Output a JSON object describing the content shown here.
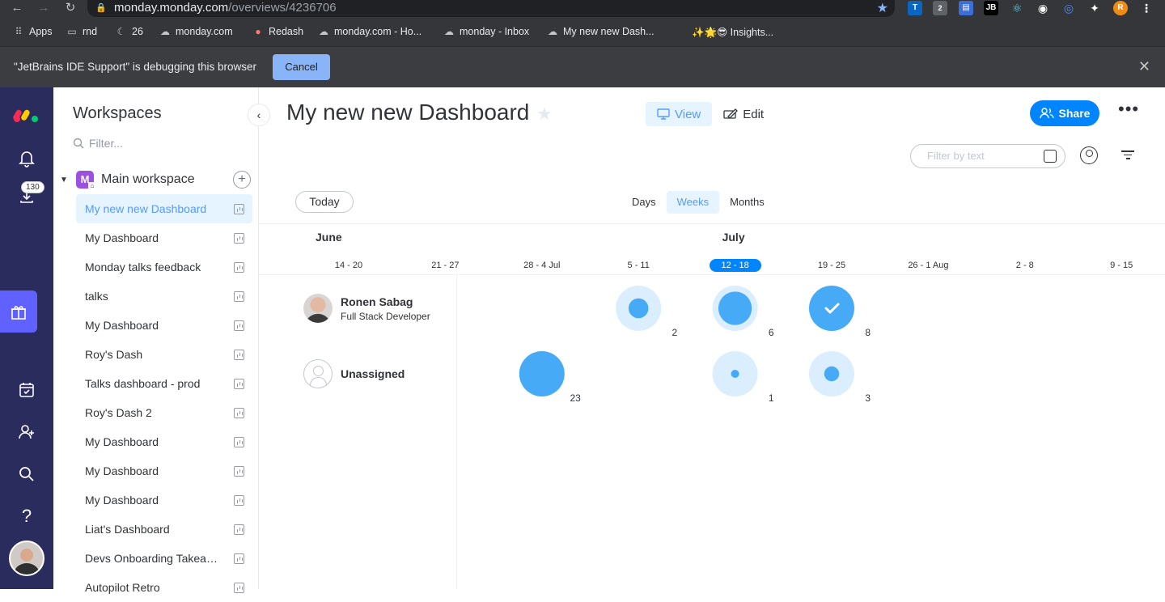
{
  "browser": {
    "url_host": "monday.monday.com",
    "url_path": "/overviews/4236706",
    "bookmarks": [
      {
        "label": "Apps",
        "icon": "apps-grid-icon"
      },
      {
        "label": "rnd",
        "icon": "folder-icon"
      },
      {
        "label": "26",
        "icon": "moon-icon"
      },
      {
        "label": "monday.com",
        "icon": "cloud-icon"
      },
      {
        "label": "Redash",
        "icon": "redash-icon"
      },
      {
        "label": "monday.com - Ho...",
        "icon": "cloud-icon"
      },
      {
        "label": "monday - Inbox",
        "icon": "cloud-icon"
      },
      {
        "label": "My new new Dash...",
        "icon": "cloud-icon"
      },
      {
        "label": "✨🌟😎 Insights...",
        "icon": ""
      }
    ],
    "ext_badge": "2",
    "ext_jb": "JB",
    "profile_initial": "R",
    "infobar": {
      "message": "\"JetBrains IDE Support\" is debugging this browser",
      "cancel": "Cancel"
    }
  },
  "rail": {
    "download_badge": "130"
  },
  "sidebar": {
    "title": "Workspaces",
    "filter_placeholder": "Filter...",
    "workspace_initial": "M",
    "workspace_name": "Main workspace",
    "dashboards": [
      "My new new Dashboard",
      "My Dashboard",
      "Monday talks feedback",
      "talks",
      "My Dashboard",
      "Roy's Dash",
      "Talks dashboard - prod",
      "Roy's Dash 2",
      "My Dashboard",
      "My Dashboard",
      "My Dashboard",
      "Liat's Dashboard",
      "Devs Onboarding Takeawa...",
      "Autopilot Retro"
    ]
  },
  "main": {
    "title": "My new new Dashboard",
    "view_label": "View",
    "edit_label": "Edit",
    "share_label": "Share",
    "filter_placeholder": "Filter by text",
    "today_label": "Today",
    "scales": [
      "Days",
      "Weeks",
      "Months"
    ],
    "selected_scale": "Weeks"
  },
  "timeline": {
    "months": [
      {
        "label": "June"
      },
      {
        "label": "July"
      }
    ],
    "weeks": [
      "14 - 20",
      "21 - 27",
      "28 - 4 Jul",
      "5 - 11",
      "12 - 18",
      "19 - 25",
      "26 - 1 Aug",
      "2 - 8",
      "9 - 15"
    ],
    "current_week": "12 - 18",
    "people": [
      {
        "name": "Ronen Sabag",
        "role": "Full Stack Developer",
        "avatar": "photo",
        "workload": [
          {
            "week": "5 - 11",
            "count": "2",
            "level": 0.3
          },
          {
            "week": "12 - 18",
            "count": "6",
            "level": 0.85
          },
          {
            "week": "19 - 25",
            "count": "8",
            "level": 1.0,
            "done": true
          }
        ]
      },
      {
        "name": "Unassigned",
        "role": "",
        "avatar": "empty",
        "workload": [
          {
            "week": "28 - 4 Jul",
            "count": "23",
            "level": 1.0
          },
          {
            "week": "12 - 18",
            "count": "1",
            "level": 0.05
          },
          {
            "week": "19 - 25",
            "count": "3",
            "level": 0.17
          }
        ]
      }
    ]
  },
  "colors": {
    "accent": "#0085ff",
    "bubble_bg": "#dbeefe",
    "bubble_fill": "#47aaf7",
    "rail": "#2b2c5e",
    "rail_active": "#6161ff",
    "workspace_icon": "#9d50dd"
  }
}
